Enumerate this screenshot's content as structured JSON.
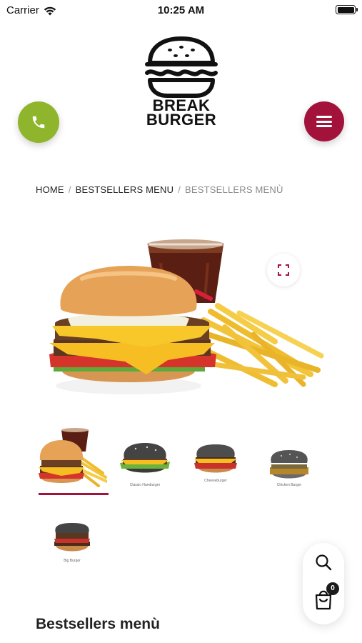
{
  "status_bar": {
    "carrier": "Carrier",
    "time": "10:25 AM"
  },
  "header": {
    "logo_line1": "BREAK",
    "logo_line2": "BURGER",
    "phone_icon": "phone-icon",
    "menu_icon": "hamburger-menu-icon",
    "phone_color": "#8fb52c",
    "menu_color": "#a3123a"
  },
  "breadcrumb": {
    "home": "HOME",
    "parent": "BESTSELLERS MENU",
    "current": "BESTSELLERS MENÙ",
    "separator": "/"
  },
  "product": {
    "zoom_icon": "expand-icon"
  },
  "thumbnails": [
    {
      "caption": "",
      "active": true
    },
    {
      "caption": "Classic Hamburger",
      "active": false
    },
    {
      "caption": "Cheeseburger",
      "active": false
    },
    {
      "caption": "Chicken Burger",
      "active": false
    },
    {
      "caption": "Big Burger",
      "active": false
    }
  ],
  "fab": {
    "search_icon": "search-icon",
    "cart_icon": "shopping-bag-icon",
    "cart_count": "0"
  },
  "section": {
    "title": "Bestsellers menù"
  },
  "colors": {
    "accent": "#a3123a",
    "green": "#8fb52c"
  }
}
